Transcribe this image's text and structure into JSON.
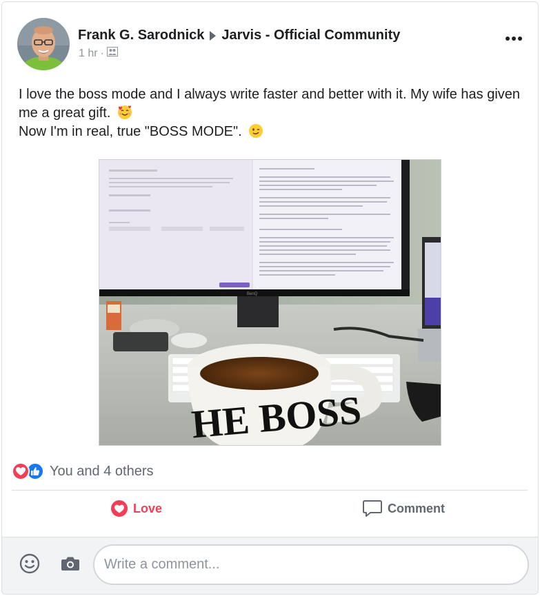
{
  "post": {
    "author": "Frank G. Sarodnick",
    "group": "Jarvis - Official Community",
    "time": "1 hr",
    "privacy_icon": "group-privacy-icon",
    "more_icon": "more-options-icon",
    "text_line1": "I love the boss mode and I always write faster and better with it. My wife has given me a great gift.",
    "text_line2": "Now I'm in real, true \"BOSS MODE\".",
    "photo_mug_text": "HE BOSS"
  },
  "reactions": {
    "summary": "You and 4 others",
    "icons": [
      "love-reaction-icon",
      "like-reaction-icon"
    ]
  },
  "actions": {
    "love_label": "Love",
    "comment_label": "Comment"
  },
  "composer": {
    "placeholder": "Write a comment..."
  },
  "colors": {
    "love": "#f33e58",
    "like": "#1877f2",
    "muted": "#606770"
  }
}
